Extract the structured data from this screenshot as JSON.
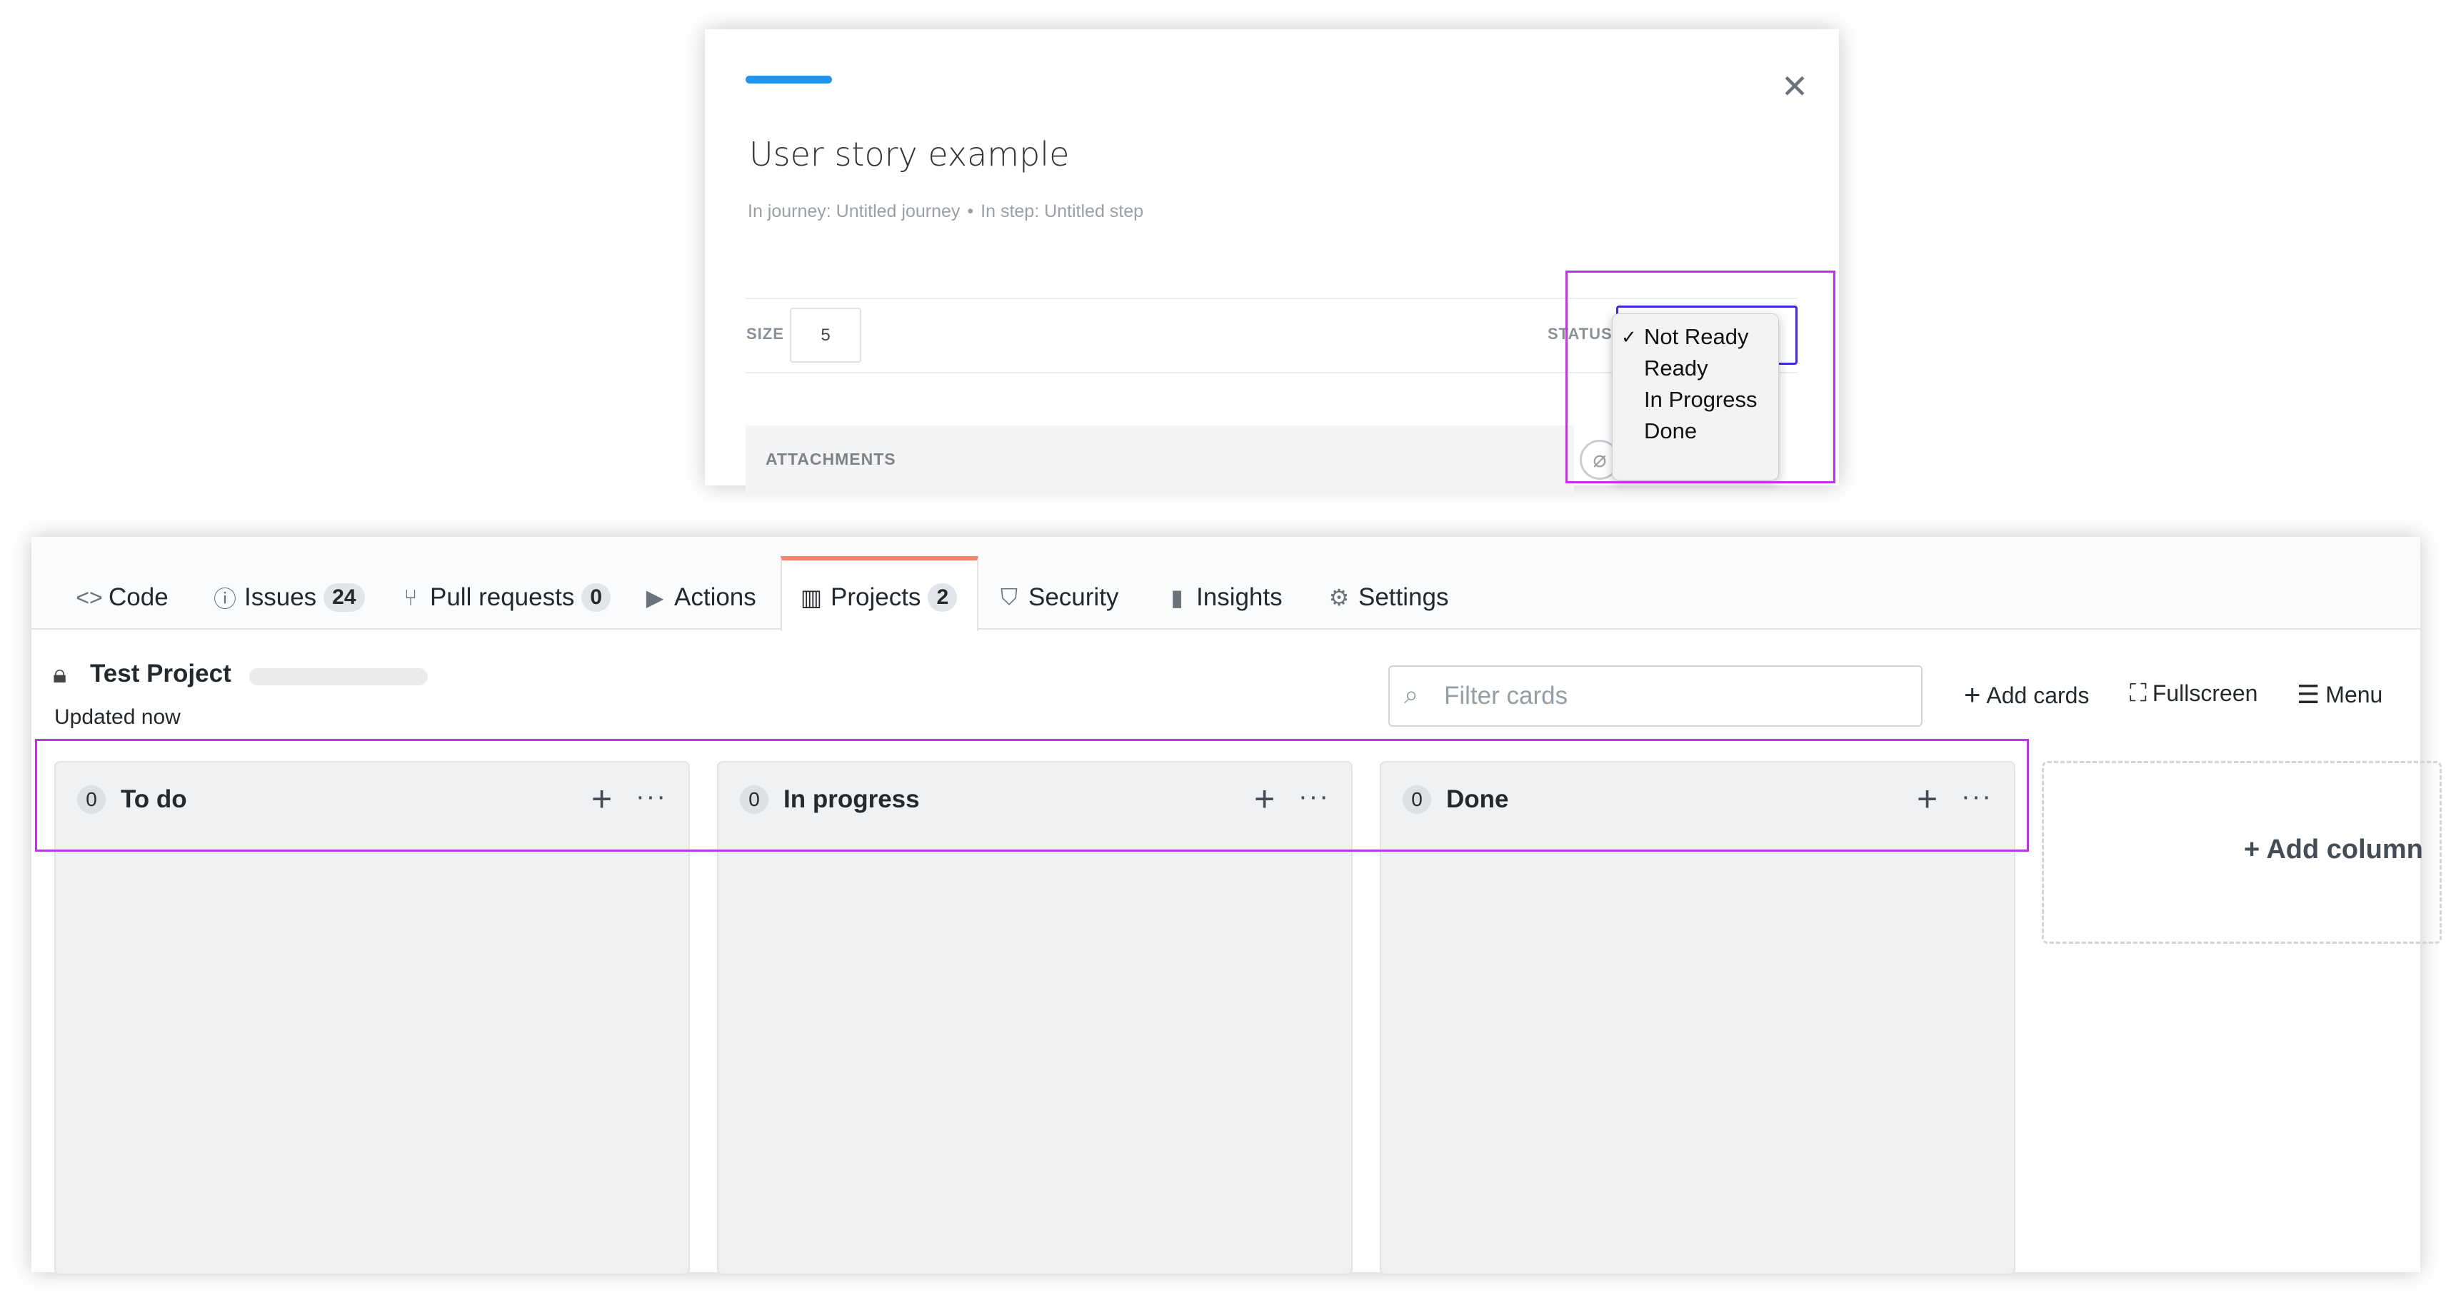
{
  "modal": {
    "title": "User story example",
    "meta_journey": "In journey: Untitled journey",
    "meta_separator": "•",
    "meta_step": "In step: Untitled step",
    "close_icon": "close-icon",
    "size_label": "SIZE",
    "size_value": "5",
    "status_label": "STATUS",
    "status_options": [
      {
        "label": "Not Ready",
        "checked": "✓"
      },
      {
        "label": "Ready",
        "checked": ""
      },
      {
        "label": "In Progress",
        "checked": ""
      },
      {
        "label": "Done",
        "checked": ""
      }
    ],
    "attachments_label": "ATTACHMENTS",
    "accent_color": "#1e94f3"
  },
  "repo_nav": {
    "tabs": [
      {
        "icon": "code-icon",
        "glyph": "<>",
        "label": "Code",
        "count": ""
      },
      {
        "icon": "issues-icon",
        "glyph": "ⓘ",
        "label": "Issues",
        "count": "24"
      },
      {
        "icon": "pull-request-icon",
        "glyph": "⑂",
        "label": "Pull requests",
        "count": "0"
      },
      {
        "icon": "actions-icon",
        "glyph": "▶",
        "label": "Actions",
        "count": ""
      },
      {
        "icon": "projects-icon",
        "glyph": "▥",
        "label": "Projects",
        "count": "2"
      },
      {
        "icon": "security-icon",
        "glyph": "⛉",
        "label": "Security",
        "count": ""
      },
      {
        "icon": "insights-icon",
        "glyph": "▮",
        "label": "Insights",
        "count": ""
      },
      {
        "icon": "settings-icon",
        "glyph": "⚙",
        "label": "Settings",
        "count": ""
      }
    ],
    "selected_tab": "Projects",
    "selected_accent": "#f9826c"
  },
  "project": {
    "title": "Test Project",
    "updated": "Updated now",
    "filter_placeholder": "Filter cards",
    "add_cards": "Add cards",
    "fullscreen": "Fullscreen",
    "menu": "Menu",
    "columns": [
      {
        "name": "To do",
        "count": "0"
      },
      {
        "name": "In progress",
        "count": "0"
      },
      {
        "name": "Done",
        "count": "0"
      }
    ],
    "add_column": "+ Add column"
  },
  "highlight_color": "#c531e6"
}
